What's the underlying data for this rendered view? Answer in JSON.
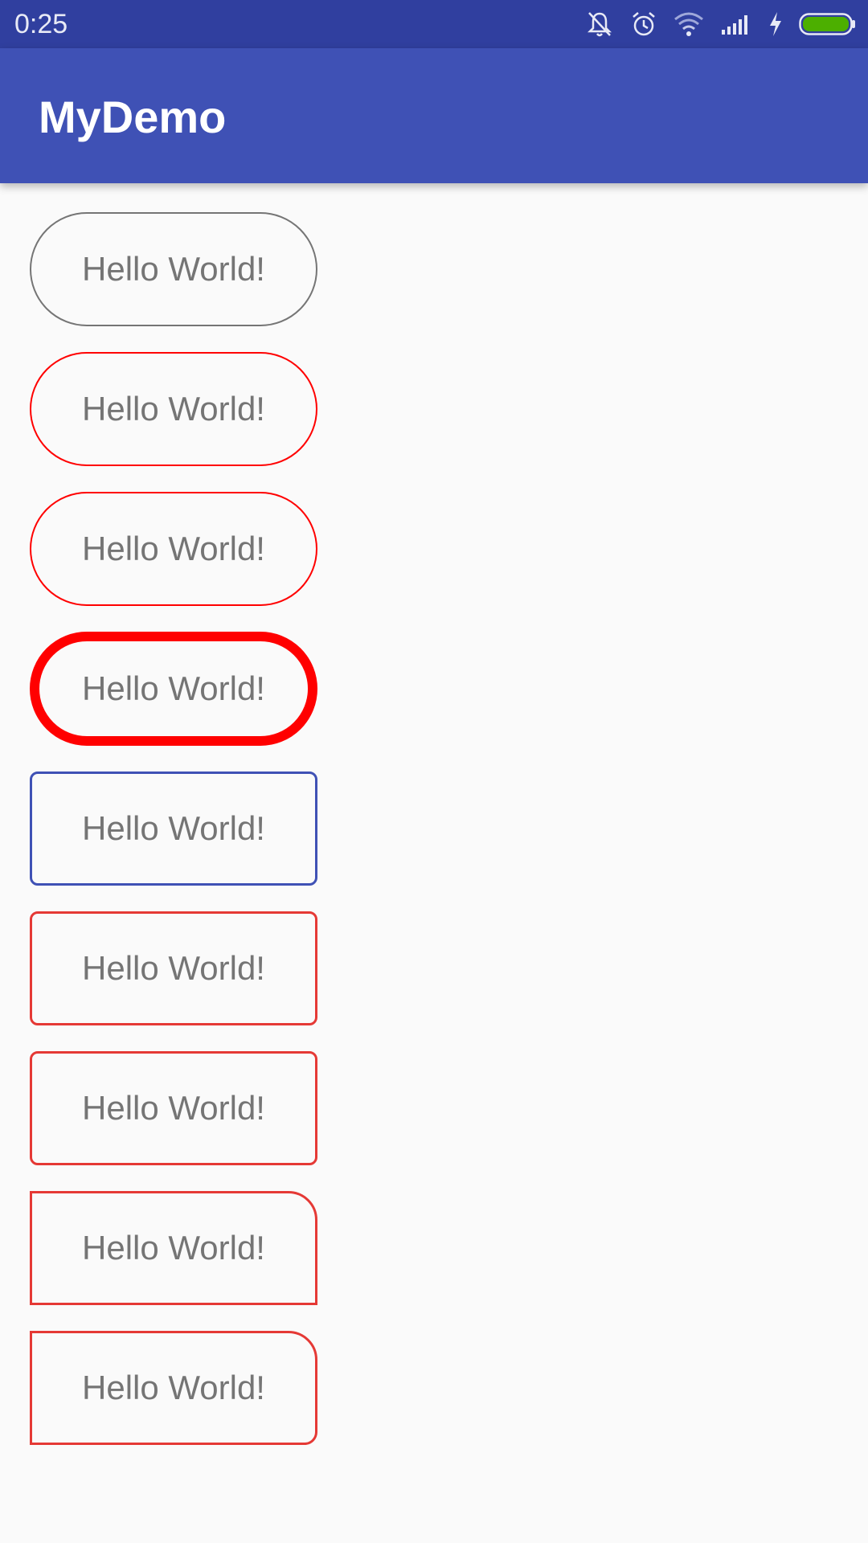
{
  "status_bar": {
    "time": "0:25",
    "icons": [
      "mute-icon",
      "alarm-icon",
      "wifi-icon",
      "signal-icon",
      "charging-icon",
      "battery-icon"
    ],
    "battery_color": "#4caf00"
  },
  "app_bar": {
    "title": "MyDemo",
    "color": "#3f51b5"
  },
  "buttons": [
    {
      "label": "Hello World!",
      "border_color": "#757575"
    },
    {
      "label": "Hello World!",
      "border_color": "#ff0000"
    },
    {
      "label": "Hello World!",
      "border_color": "#ff0000"
    },
    {
      "label": "Hello World!",
      "border_color": "#ff0000"
    },
    {
      "label": "Hello World!",
      "border_color": "#3f51b5"
    },
    {
      "label": "Hello World!",
      "border_color": "#e53935"
    },
    {
      "label": "Hello World!",
      "border_color": "#e53935"
    },
    {
      "label": "Hello World!",
      "border_color": "#e53935"
    },
    {
      "label": "Hello World!",
      "border_color": "#e53935"
    }
  ]
}
